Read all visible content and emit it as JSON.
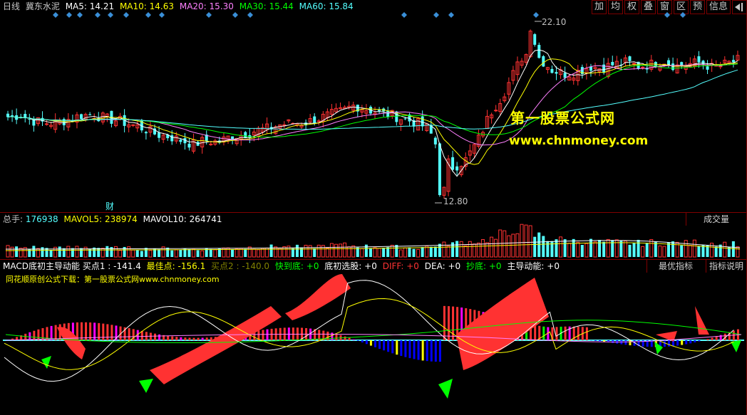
{
  "colors": {
    "up": "#ff3232",
    "down": "#54ffff",
    "ma5": "#ffffff",
    "ma10": "#ffff00",
    "ma20": "#ff80ff",
    "ma30": "#00ff00",
    "ma60": "#54ffff",
    "panel_border": "#800000"
  },
  "header": {
    "period": "日线",
    "stock_name": "冀东水泥",
    "ma5_label": "MA5:",
    "ma5_value": "14.21",
    "ma10_label": "MA10:",
    "ma10_value": "14.63",
    "ma20_label": "MA20:",
    "ma20_value": "15.30",
    "ma30_label": "MA30:",
    "ma30_value": "15.44",
    "ma60_label": "MA60:",
    "ma60_value": "15.84"
  },
  "toolbar": {
    "buttons": [
      "加",
      "均",
      "权",
      "叠",
      "窗",
      "区",
      "预",
      "信息"
    ],
    "exit_icon": "exit-icon"
  },
  "price_panel": {
    "high_label": "22.10",
    "low_label": "12.80",
    "finance_marker": "财"
  },
  "volume_panel": {
    "total_label": "总手:",
    "total_value": "176938",
    "mavol5_label": "MAVOL5:",
    "mavol5_value": "238974",
    "mavol10_label": "MAVOL10:",
    "mavol10_value": "264741",
    "selector": "成交量"
  },
  "indicator_panel": {
    "name": "MACD底初主导动能",
    "buy1_label": "买点1 :",
    "buy1_value": "-141.4",
    "best_label": "最佳点:",
    "best_value": "-156.1",
    "buy2_label": "买点2 :",
    "buy2_value": "-140.0",
    "fast_label": "快到底:",
    "fast_value": "+0",
    "initial_label": "底初选股:",
    "initial_value": "+0",
    "diff_label": "DIFF:",
    "diff_value": "+0",
    "dea_label": "DEA:",
    "dea_value": "+0",
    "bottom_label": "抄底:",
    "bottom_value": "+0",
    "momentum_label": "主导动能:",
    "momentum_value": "+0",
    "best_indicator_button": "最优指标",
    "indicator_help_button": "指标说明",
    "ad_text": "同花顺原创公式下载：第一股票公式网www.chnmoney.com"
  },
  "watermark": {
    "line1": "第一股票公式网",
    "line2": "www.chnmoney.com"
  },
  "chart_data": {
    "type": "candlestick",
    "price_range": [
      12.8,
      22.1
    ],
    "ohlc_close_approx": [
      17.2,
      17.3,
      17.0,
      16.9,
      16.9,
      17.1,
      17.3,
      17.3,
      17.1,
      17.0,
      16.8,
      16.6,
      16.3,
      16.2,
      16.0,
      15.8,
      16.0,
      15.9,
      16.2,
      16.3,
      16.5,
      16.6,
      16.8,
      16.9,
      16.9,
      17.1,
      17.3,
      17.5,
      17.8,
      17.6,
      17.4,
      17.3,
      17.1,
      16.9,
      16.6,
      15.2,
      14.6,
      15.0,
      16.0,
      17.4,
      18.3,
      19.6,
      20.8,
      20.2,
      19.6,
      19.4,
      19.5,
      19.8,
      19.7,
      19.9,
      20.0,
      19.8,
      19.9,
      20.1,
      19.8,
      19.9,
      20.0,
      19.7,
      19.9,
      20.1
    ],
    "volume_bars": [
      32,
      30,
      31,
      29,
      28,
      30,
      33,
      31,
      29,
      28,
      27,
      26,
      28,
      27,
      26,
      25,
      26,
      27,
      29,
      30,
      31,
      33,
      34,
      32,
      31,
      35,
      37,
      38,
      36,
      34,
      33,
      32,
      31,
      30,
      33,
      40,
      45,
      48,
      52,
      58,
      72,
      95,
      88,
      70,
      60,
      55,
      52,
      50,
      48,
      47,
      46,
      45,
      47,
      46,
      45,
      44,
      46,
      45,
      44,
      43
    ]
  }
}
